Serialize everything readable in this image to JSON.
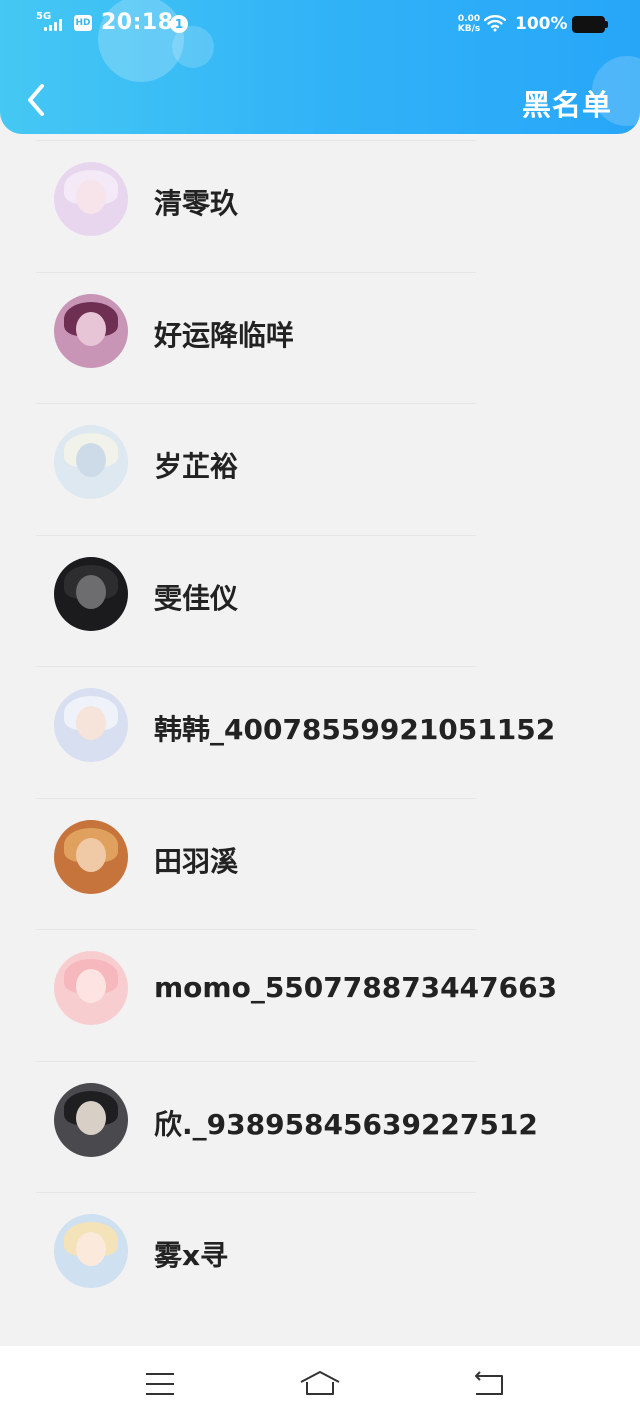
{
  "status_bar": {
    "network": "5G",
    "hd": "HD",
    "time": "20:18",
    "notification_count": "1",
    "speed_value": "0.00",
    "speed_unit": "KB/s",
    "battery": "100%"
  },
  "header": {
    "title": "黑名单",
    "back_icon": "chevron-left-icon",
    "background": "#31b3f7"
  },
  "blacklist": [
    {
      "name": "清零玖",
      "avatar_bg": "#e8d6ef",
      "avatar_hair": "#f3e9f7",
      "avatar_face": "#f7e3ea"
    },
    {
      "name": "好运降临咩",
      "avatar_bg": "#c995b6",
      "avatar_hair": "#6e2f52",
      "avatar_face": "#e7c4d6"
    },
    {
      "name": "岁芷裕",
      "avatar_bg": "#dde8f0",
      "avatar_hair": "#f1f3ea",
      "avatar_face": "#cddbe8"
    },
    {
      "name": "雯佳仪",
      "avatar_bg": "#1b1b1d",
      "avatar_hair": "#2d2d30",
      "avatar_face": "#6d6d70"
    },
    {
      "name": "韩韩_4007855992105115​2",
      "avatar_bg": "#d7dff0",
      "avatar_hair": "#f0f2fa",
      "avatar_face": "#f6e3da"
    },
    {
      "name": "田羽溪",
      "avatar_bg": "#c7743c",
      "avatar_hair": "#e0a15e",
      "avatar_face": "#f0c9a6"
    },
    {
      "name": "momo_550778873447663",
      "avatar_bg": "#f8cdd0",
      "avatar_hair": "#f6b8bd",
      "avatar_face": "#fde4e3"
    },
    {
      "name": "欣._93895845639227512",
      "avatar_bg": "#4a4a4e",
      "avatar_hair": "#1f1f22",
      "avatar_face": "#d8cfc6"
    },
    {
      "name": "雾x寻",
      "avatar_bg": "#cfe0f0",
      "avatar_hair": "#f4e2b8",
      "avatar_face": "#fbe9dc"
    }
  ],
  "navbar": {
    "menu_icon": "menu-icon",
    "home_icon": "home-icon",
    "back_icon": "back-icon"
  }
}
